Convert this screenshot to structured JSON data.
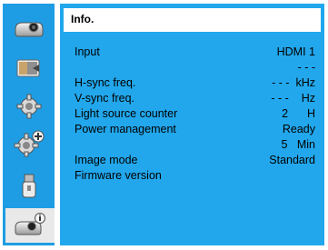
{
  "sidebar": {
    "items": [
      {
        "icon": "projector-icon"
      },
      {
        "icon": "display-adjust-icon"
      },
      {
        "icon": "gear-icon"
      },
      {
        "icon": "gear-plus-icon"
      },
      {
        "icon": "usb-icon"
      },
      {
        "icon": "projector-info-icon"
      }
    ],
    "selected_index": 5
  },
  "panel": {
    "title": "Info.",
    "rows": [
      {
        "label": "Input",
        "value": "HDMI 1"
      },
      {
        "label": "",
        "value": "- - -"
      },
      {
        "label": "H-sync freq.",
        "value": "- - -  kHz"
      },
      {
        "label": "V-sync freq.",
        "value": "- - -    Hz"
      },
      {
        "label": "Light source counter",
        "value": "2      H"
      },
      {
        "label": "Power management",
        "value": "Ready"
      },
      {
        "label": "",
        "value": "5   Min"
      },
      {
        "label": "Image mode",
        "value": "Standard"
      },
      {
        "label": "Firmware version",
        "value": ""
      }
    ]
  },
  "colors": {
    "sidebar_bg": "#1e9de4",
    "panel_bg": "#22a7ec",
    "selected_item_bg": "#e9e9e9"
  }
}
